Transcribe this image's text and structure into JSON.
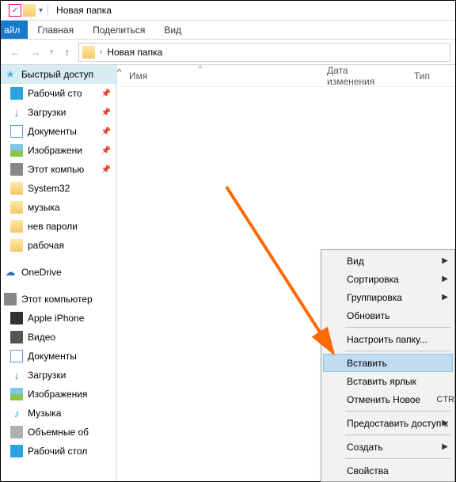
{
  "window": {
    "title": "Новая папка"
  },
  "ribbon": {
    "file": "айл",
    "tabs": [
      "Главная",
      "Поделиться",
      "Вид"
    ]
  },
  "address": {
    "crumb": "Новая папка"
  },
  "columns": {
    "name": "Имя",
    "date": "Дата изменения",
    "type": "Тип"
  },
  "sidebar": {
    "quick": "Быстрый доступ",
    "items1": [
      {
        "label": "Рабочий сто",
        "icon": "desktop",
        "pin": true
      },
      {
        "label": "Загрузки",
        "icon": "down",
        "pin": true
      },
      {
        "label": "Документы",
        "icon": "doc",
        "pin": true
      },
      {
        "label": "Изображени",
        "icon": "img",
        "pin": true
      },
      {
        "label": "Этот компью",
        "icon": "pc",
        "pin": true
      },
      {
        "label": "System32",
        "icon": "folder",
        "pin": false
      },
      {
        "label": "музыка",
        "icon": "folder",
        "pin": false
      },
      {
        "label": "нев пароли",
        "icon": "folder",
        "pin": false
      },
      {
        "label": "рабочая",
        "icon": "folder",
        "pin": false
      }
    ],
    "onedrive": "OneDrive",
    "thispc": "Этот компьютер",
    "items2": [
      {
        "label": "Apple iPhone",
        "icon": "phone"
      },
      {
        "label": "Видео",
        "icon": "video"
      },
      {
        "label": "Документы",
        "icon": "doc"
      },
      {
        "label": "Загрузки",
        "icon": "down"
      },
      {
        "label": "Изображения",
        "icon": "img"
      },
      {
        "label": "Музыка",
        "icon": "music"
      },
      {
        "label": "Объемные об",
        "icon": "drive"
      },
      {
        "label": "Рабочий стол",
        "icon": "desktop"
      }
    ]
  },
  "context_menu": {
    "items": [
      {
        "label": "Вид",
        "sub": true
      },
      {
        "label": "Сортировка",
        "sub": true
      },
      {
        "label": "Группировка",
        "sub": true
      },
      {
        "label": "Обновить"
      },
      "sep",
      {
        "label": "Настроить папку..."
      },
      "sep",
      {
        "label": "Вставить",
        "hi": true
      },
      {
        "label": "Вставить ярлык"
      },
      {
        "label": "Отменить Новое",
        "shortcut": "CTR"
      },
      "sep",
      {
        "label": "Предоставить доступ к",
        "sub": true
      },
      "sep",
      {
        "label": "Создать",
        "sub": true
      },
      "sep",
      {
        "label": "Свойства"
      }
    ]
  }
}
